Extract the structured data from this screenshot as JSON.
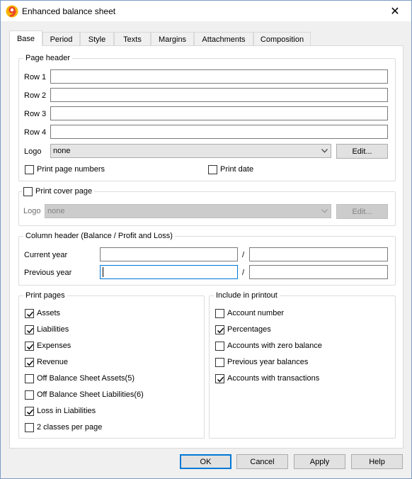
{
  "window": {
    "title": "Enhanced balance sheet",
    "app_icon": "banana-app-icon",
    "close_glyph": "✕"
  },
  "tabs": [
    {
      "label": "Base",
      "active": true
    },
    {
      "label": "Period",
      "active": false
    },
    {
      "label": "Style",
      "active": false
    },
    {
      "label": "Texts",
      "active": false
    },
    {
      "label": "Margins",
      "active": false
    },
    {
      "label": "Attachments",
      "active": false
    },
    {
      "label": "Composition",
      "active": false
    }
  ],
  "page_header": {
    "title": "Page header",
    "rows": [
      {
        "label": "Row 1",
        "value": ""
      },
      {
        "label": "Row 2",
        "value": ""
      },
      {
        "label": "Row 3",
        "value": ""
      },
      {
        "label": "Row 4",
        "value": ""
      }
    ],
    "logo_label": "Logo",
    "logo_value": "none",
    "edit_label": "Edit...",
    "print_page_numbers": {
      "label": "Print page numbers",
      "checked": false
    },
    "print_date": {
      "label": "Print date",
      "checked": false
    }
  },
  "cover_page": {
    "title": "Print cover page",
    "checked": false,
    "logo_label": "Logo",
    "logo_value": "none",
    "edit_label": "Edit..."
  },
  "column_header": {
    "title": "Column header (Balance / Profit and Loss)",
    "current_year": {
      "label": "Current year",
      "value1": "",
      "value2": ""
    },
    "previous_year": {
      "label": "Previous year",
      "value1": "",
      "value2": ""
    },
    "separator": "/"
  },
  "print_pages": {
    "title": "Print pages",
    "items": [
      {
        "label": "Assets",
        "checked": true
      },
      {
        "label": "Liabilities",
        "checked": true
      },
      {
        "label": "Expenses",
        "checked": true
      },
      {
        "label": "Revenue",
        "checked": true
      },
      {
        "label": "Off Balance Sheet Assets(5)",
        "checked": false
      },
      {
        "label": "Off Balance Sheet Liabilities(6)",
        "checked": false
      },
      {
        "label": "Loss in Liabilities",
        "checked": true
      },
      {
        "label": "2 classes per page",
        "checked": false
      }
    ]
  },
  "include_printout": {
    "title": "Include in printout",
    "items": [
      {
        "label": "Account number",
        "checked": false
      },
      {
        "label": "Percentages",
        "checked": true
      },
      {
        "label": "Accounts with zero balance",
        "checked": false
      },
      {
        "label": "Previous year balances",
        "checked": false
      },
      {
        "label": "Accounts with transactions",
        "checked": true
      }
    ]
  },
  "buttons": {
    "ok": "OK",
    "cancel": "Cancel",
    "apply": "Apply",
    "help": "Help"
  },
  "colors": {
    "focus_blue": "#0078d7",
    "app_icon_red": "#e8412c",
    "app_icon_yellow": "#f5b400"
  }
}
